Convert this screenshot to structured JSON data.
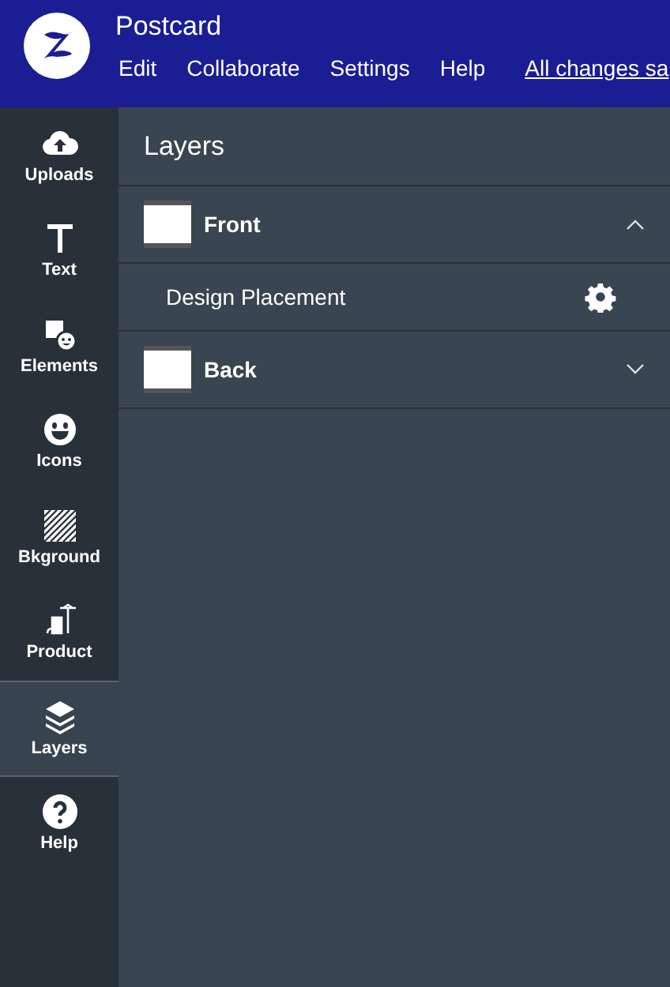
{
  "header": {
    "title": "Postcard",
    "menu": [
      "Edit",
      "Collaborate",
      "Settings",
      "Help"
    ],
    "save_status": "All changes sa"
  },
  "sidebar": {
    "items": [
      {
        "kind": "uploads",
        "label": "Uploads",
        "selected": false
      },
      {
        "kind": "text",
        "label": "Text",
        "selected": false
      },
      {
        "kind": "elements",
        "label": "Elements",
        "selected": false
      },
      {
        "kind": "icons",
        "label": "Icons",
        "selected": false
      },
      {
        "kind": "background",
        "label": "Bkground",
        "selected": false
      },
      {
        "kind": "product",
        "label": "Product",
        "selected": false
      },
      {
        "kind": "layers",
        "label": "Layers",
        "selected": true
      },
      {
        "kind": "help",
        "label": "Help",
        "selected": false
      }
    ]
  },
  "panel": {
    "title": "Layers",
    "sides": [
      {
        "label": "Front",
        "expanded": true,
        "children": [
          {
            "label": "Design Placement"
          }
        ]
      },
      {
        "label": "Back",
        "expanded": false
      }
    ]
  }
}
